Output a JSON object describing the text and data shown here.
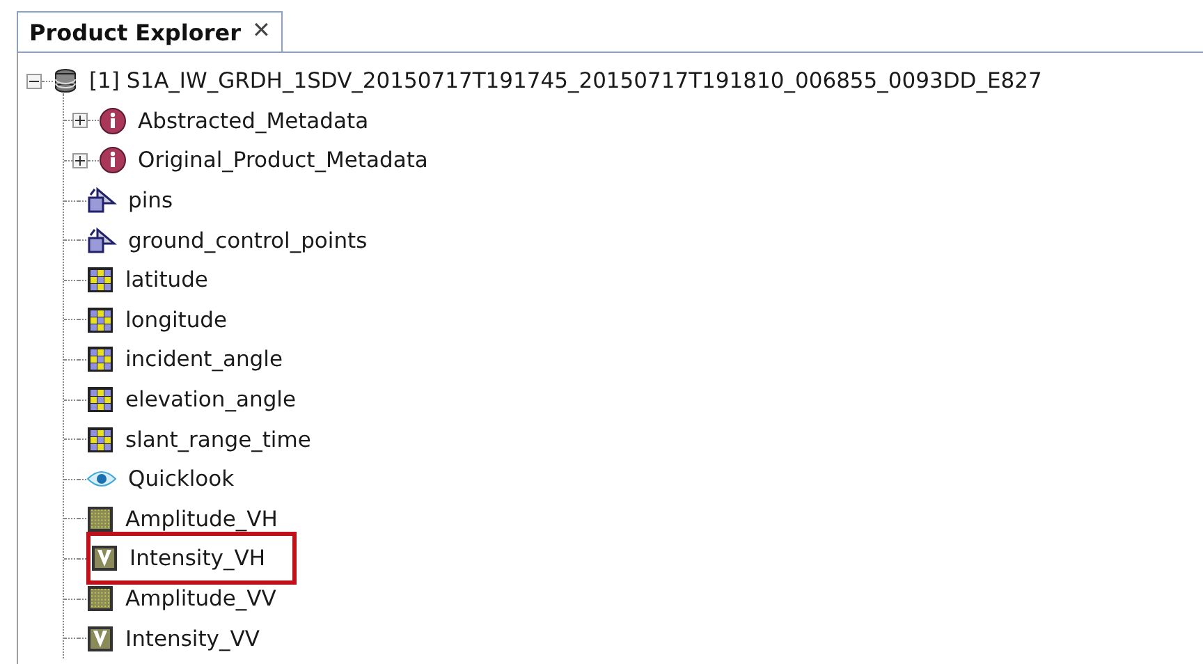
{
  "tab": {
    "title": "Product Explorer",
    "close": "✕",
    "selected": true
  },
  "tree": [
    {
      "label": "[1] S1A_IW_GRDH_1SDV_20150717T191745_20150717T191810_006855_0093DD_E827",
      "kind": "product",
      "expanded": true,
      "children": [
        {
          "label": "Abstracted_Metadata",
          "kind": "metadata",
          "expanded": false,
          "highlighted": false
        },
        {
          "label": "Original_Product_Metadata",
          "kind": "metadata",
          "expanded": false,
          "highlighted": false
        },
        {
          "label": "pins",
          "kind": "vector",
          "highlighted": false
        },
        {
          "label": "ground_control_points",
          "kind": "vector",
          "highlighted": false
        },
        {
          "label": "latitude",
          "kind": "tiepoint",
          "highlighted": false
        },
        {
          "label": "longitude",
          "kind": "tiepoint",
          "highlighted": false
        },
        {
          "label": "incident_angle",
          "kind": "tiepoint",
          "highlighted": false
        },
        {
          "label": "elevation_angle",
          "kind": "tiepoint",
          "highlighted": false
        },
        {
          "label": "slant_range_time",
          "kind": "tiepoint",
          "highlighted": false
        },
        {
          "label": "Quicklook",
          "kind": "quicklook",
          "highlighted": false
        },
        {
          "label": "Amplitude_VH",
          "kind": "band",
          "highlighted": false
        },
        {
          "label": "Intensity_VH",
          "kind": "virtual",
          "highlighted": true
        },
        {
          "label": "Amplitude_VV",
          "kind": "band",
          "highlighted": false
        },
        {
          "label": "Intensity_VV",
          "kind": "virtual",
          "highlighted": false
        }
      ]
    }
  ]
}
